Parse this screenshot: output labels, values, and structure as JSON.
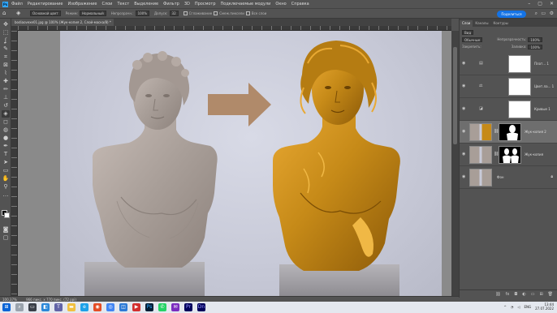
{
  "app": {
    "logo": "Ps",
    "menu": [
      "Файл",
      "Редактирование",
      "Изображение",
      "Слои",
      "Текст",
      "Выделение",
      "Фильтр",
      "3D",
      "Просмотр",
      "Подключаемые модули",
      "Окно",
      "Справка"
    ]
  },
  "options": {
    "preset": "Основной цвет",
    "mode_label": "Режим:",
    "mode_value": "Нормальный",
    "opacity_label": "Непрозрачн.:",
    "opacity_value": "100%",
    "tolerance_label": "Допуск:",
    "tolerance_value": "32",
    "antialias": "Сглаживание",
    "contiguous": "Смеж.пиксели",
    "all_layers": "Все слои",
    "share_button": "Поделиться"
  },
  "document": {
    "tab_title": "bodiaovexe01.jpg @ 100% (Жук-копия 2, Слой-маска/8) *"
  },
  "status": {
    "zoom": "100,37%",
    "info": "966 пикс. x 770 пикс. (72 ppi)"
  },
  "panels": {
    "tabs": [
      "Слои",
      "Каналы",
      "Контуры"
    ],
    "kind_label": "Вид",
    "blend_mode": "Обычные",
    "opacity_label": "Непрозрачность:",
    "opacity_value": "100%",
    "lock_label": "Закрепить:",
    "fill_label": "Заливка:",
    "fill_value": "100%",
    "layers": [
      {
        "name": "Плат... 1",
        "type": "adjustment",
        "selected": false
      },
      {
        "name": "Цвет.ла... 1",
        "type": "adjustment",
        "selected": false
      },
      {
        "name": "Кривые 1",
        "type": "adjustment",
        "selected": false
      },
      {
        "name": "Жук-копия 2",
        "type": "masked",
        "selected": true
      },
      {
        "name": "Жук-копия",
        "type": "masked",
        "selected": false
      },
      {
        "name": "Фон",
        "type": "background",
        "selected": false
      }
    ]
  },
  "taskbar": {
    "lang": "ENG",
    "time": "13:44",
    "date": "27.07.2022"
  },
  "colors": {
    "accent": "#1473e6",
    "gold": "#c68a18",
    "arrow": "#b08a6a",
    "stone": "#a89e98"
  }
}
